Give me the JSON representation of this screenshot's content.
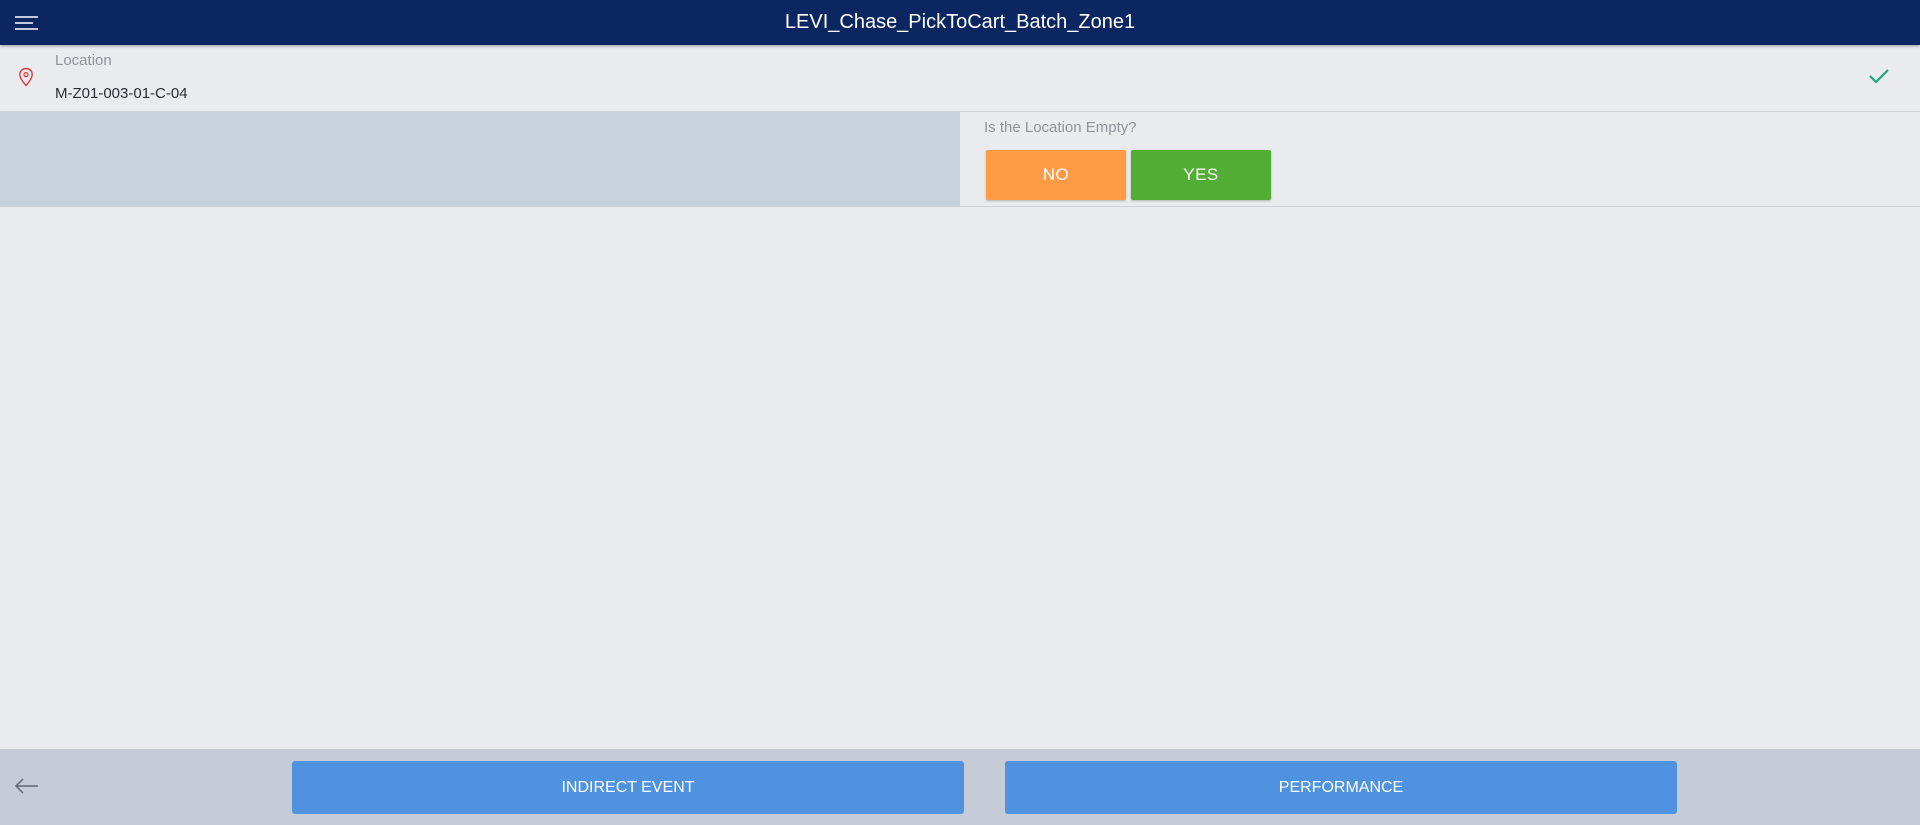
{
  "header": {
    "title": "LEVI_Chase_PickToCart_Batch_Zone1",
    "menu_icon": "hamburger-menu-icon",
    "background_color": "#0b2660"
  },
  "location": {
    "label": "Location",
    "value": "M-Z01-003-01-C-04",
    "icon": "map-pin-icon",
    "status_icon": "check-icon",
    "icon_color": "#e53935",
    "status_color": "#1fa67a"
  },
  "question": {
    "label": "Is the Location Empty?",
    "no_label": "NO",
    "yes_label": "YES",
    "no_color": "#ff9a45",
    "yes_color": "#52ad35"
  },
  "footer": {
    "back_icon": "arrow-left-icon",
    "indirect_event_label": "INDIRECT EVENT",
    "performance_label": "PERFORMANCE",
    "button_color": "#4f93e0"
  }
}
